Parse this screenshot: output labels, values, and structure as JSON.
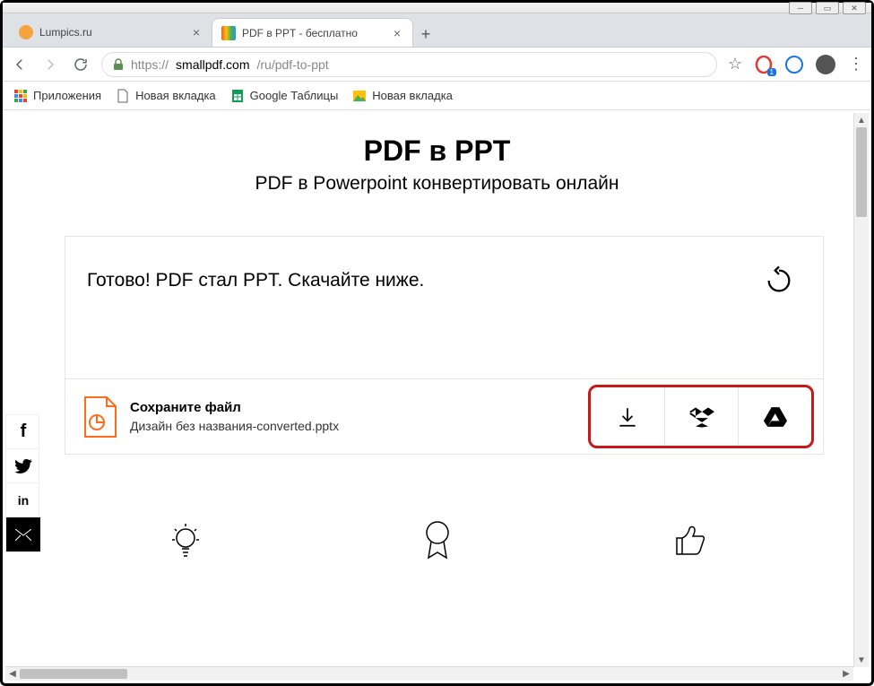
{
  "window": {
    "tabs": [
      {
        "title": "Lumpics.ru",
        "active": false,
        "favicon_color": "#f7a440"
      },
      {
        "title": "PDF в PPT - бесплатно",
        "active": true,
        "favicon_color": "#4285f4"
      }
    ]
  },
  "addressbar": {
    "lock": "🔒",
    "protocol": "https://",
    "host": "smallpdf.com",
    "path": "/ru/pdf-to-ppt"
  },
  "bookmarks": [
    {
      "label": "Приложения",
      "icon": "apps"
    },
    {
      "label": "Новая вкладка",
      "icon": "page"
    },
    {
      "label": "Google Таблицы",
      "icon": "sheets"
    },
    {
      "label": "Новая вкладка",
      "icon": "img"
    }
  ],
  "page": {
    "title": "PDF в PPT",
    "subtitle": "PDF в Powerpoint конвертировать онлайн"
  },
  "status": {
    "text": "Готово! PDF стал PPT. Скачайте ниже."
  },
  "file": {
    "save_label": "Сохраните файл",
    "filename": "Дизайн без названия-converted.pptx"
  },
  "social": {
    "facebook": "f",
    "linkedin": "in"
  },
  "download_targets": [
    "download",
    "dropbox",
    "gdrive"
  ]
}
